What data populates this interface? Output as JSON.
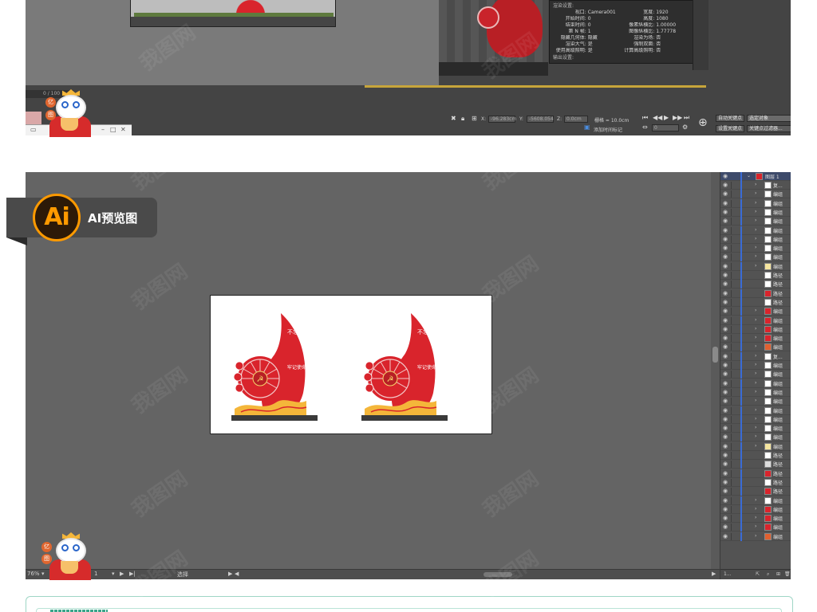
{
  "top_panel": {
    "timeline_progress": "0 / 100",
    "render_settings": {
      "header": "渲染设置:",
      "rows": [
        [
          "视口:",
          "Camera001",
          "宽度:",
          "1920"
        ],
        [
          "开始时间:",
          "0",
          "高度:",
          "1080"
        ],
        [
          "结束时间:",
          "0",
          "像素纵横比:",
          "1.00000"
        ],
        [
          "第 N 帧:",
          "1",
          "图像纵横比:",
          "1.77778"
        ],
        [
          "隐藏几何体:",
          "隐藏",
          "渲染为场:",
          "否"
        ],
        [
          "渲染大气:",
          "是",
          "强制双面:",
          "否"
        ],
        [
          "使用高级照明:",
          "是",
          "计算高级照明:",
          "否"
        ]
      ],
      "footer": "输出设置:"
    },
    "status": {
      "x_label": "X:",
      "x_value": "-96.283cm",
      "y_label": "Y:",
      "y_value": "-5608.054",
      "z_label": "Z:",
      "z_value": "0.0cm",
      "grid": "栅格 = 10.0cm",
      "add_time_tag": "添加时间标记",
      "auto_key": "自动关键点",
      "set_key": "设置关键点",
      "selected_object": "选定对象",
      "key_filters": "关键点过滤器...",
      "frame": "0"
    }
  },
  "badge": {
    "logo_text": "Ai",
    "label": "AI预览图"
  },
  "illustrator": {
    "artboard": {
      "left_sign": {
        "top_text": "不忘初心",
        "right_text": "牢记使命"
      },
      "right_sign": {
        "top_text": "不忘初心",
        "right_text": "牢记使命"
      }
    },
    "statusbar": {
      "zoom": "76%",
      "page": "1",
      "tool": "选择"
    },
    "layers": {
      "top_layer": "图层 1",
      "rows": [
        "复...",
        "编组",
        "编组",
        "编组",
        "编组",
        "编组",
        "编组",
        "编组",
        "编组",
        "编组",
        "路径",
        "路径",
        "路径",
        "路径",
        "编组",
        "编组",
        "编组",
        "编组",
        "编组",
        "复...",
        "编组",
        "编组",
        "编组",
        "编组",
        "编组",
        "编组",
        "编组",
        "编组",
        "编组",
        "编组",
        "路径",
        "路径",
        "路径",
        "路径",
        "路径",
        "编组",
        "编组",
        "编组",
        "编组",
        "编组"
      ],
      "footer_count": "1..."
    }
  },
  "mascot": {
    "top_bubble_1": "亿",
    "top_bubble_2": "图",
    "bottom_bubble_1": "亿",
    "bottom_bubble_2": "图",
    "brand": "GGG"
  },
  "watermark": "我图网",
  "colors": {
    "party_red": "#d9242c",
    "gold": "#f4b63a",
    "ai_orange": "#ff9a00",
    "panel_gray": "#646464"
  }
}
